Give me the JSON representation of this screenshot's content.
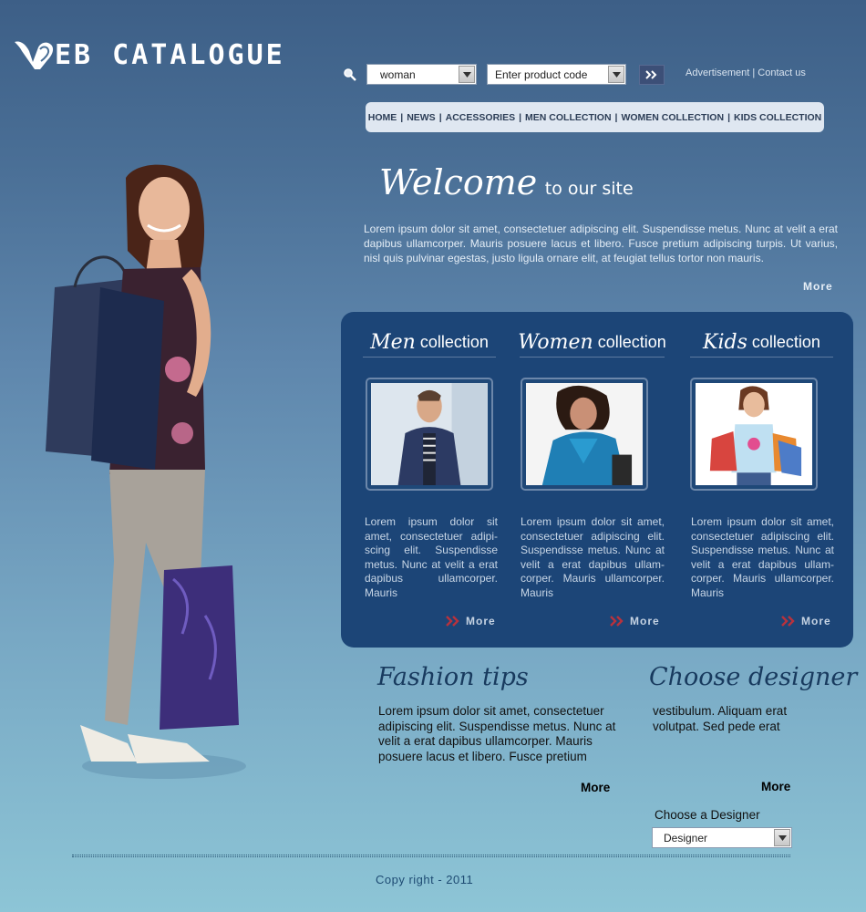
{
  "logo": {
    "text": "EB CATALOGUE"
  },
  "search": {
    "gender_value": "woman",
    "product_value": "Enter product code"
  },
  "top_links": {
    "advertisement": "Advertisement",
    "separator": "|",
    "contact": "Contact us"
  },
  "nav": {
    "items": [
      "HOME",
      "NEWS",
      "ACCESSORIES",
      "MEN COLLECTION",
      "WOMEN COLLECTION",
      "KIDS COLLECTION"
    ],
    "separator": "|"
  },
  "welcome": {
    "big": "Welcome",
    "small": "to our site",
    "text": "Lorem ipsum dolor sit amet, consectetuer adipiscing elit. Suspendisse metus. Nunc at velit a erat dapibus ullamcorper. Mauris posuere lacus et libero. Fusce pretium adipiscing turpis. Ut varius, nisl quis pulvinar egestas, justo ligula ornare elit, at feugiat tellus tortor non mauris.",
    "more": "More"
  },
  "collections": [
    {
      "script": "Men",
      "label": "collection",
      "text": "Lorem ipsum dolor sit amet, consectetuer adipi-scing elit. Suspendisse metus. Nunc at velit a erat dapibus ullamcorper. Mauris",
      "more": "More"
    },
    {
      "script": "Women",
      "label": "collection",
      "text": "Lorem ipsum dolor sit amet, consectetuer adipiscing elit. Suspendisse metus. Nunc at velit a erat dapibus ullam-corper. Mauris ullamcorper. Mauris",
      "more": "More"
    },
    {
      "script": "Kids",
      "label": "collection",
      "text": "Lorem ipsum dolor sit amet, consectetuer adipiscing elit. Suspendisse metus. Nunc at velit a erat dapibus ullam-corper. Mauris ullamcorper. Mauris",
      "more": "More"
    }
  ],
  "fashion_tips": {
    "title": "Fashion tips",
    "text": "Lorem ipsum dolor sit amet, consectetuer adipiscing elit. Suspendisse metus. Nunc at velit a erat dapibus ullamcorper. Mauris posuere lacus et libero. Fusce pretium",
    "more": "More"
  },
  "designer": {
    "title": "Choose designer",
    "text": "vestibulum. Aliquam erat volutpat. Sed pede erat",
    "more": "More",
    "label": "Choose a Designer",
    "select_value": "Designer"
  },
  "footer": {
    "copyright": "Copy right - 2011"
  },
  "colors": {
    "panel": "#1c4577",
    "nav_bg": "#dfe7f1",
    "accent_red": "#b8323d"
  }
}
